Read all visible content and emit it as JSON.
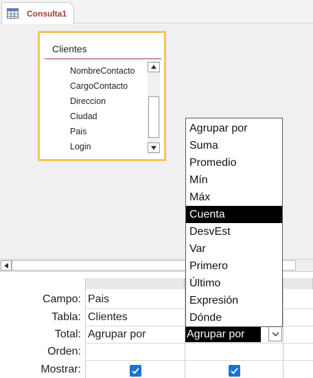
{
  "tab": {
    "title": "Consulta1",
    "icon": "query-icon"
  },
  "table": {
    "name": "Clientes",
    "fields": [
      "NombreContacto",
      "CargoContacto",
      "Direccion",
      "Ciudad",
      "Pais",
      "Login"
    ]
  },
  "grid": {
    "row_labels": {
      "field": "Campo:",
      "table": "Tabla:",
      "total": "Total:",
      "order": "Orden:",
      "show": "Mostrar:"
    },
    "columns": [
      {
        "field": "Pais",
        "table": "Clientes",
        "total": "Agrupar por",
        "order": "",
        "show": true
      },
      {
        "field": "",
        "table": "",
        "total": "Agrupar por",
        "order": "",
        "show": true
      }
    ]
  },
  "dropdown": {
    "selected": "Cuenta",
    "options": [
      "Agrupar por",
      "Suma",
      "Promedio",
      "Mín",
      "Máx",
      "Cuenta",
      "DesvEst",
      "Var",
      "Primero",
      "Último",
      "Expresión",
      "Dónde"
    ]
  },
  "colors": {
    "tab_title": "#a4373a",
    "table_border": "#f6c454",
    "checkbox": "#1a73d4",
    "selection": "#000000"
  }
}
